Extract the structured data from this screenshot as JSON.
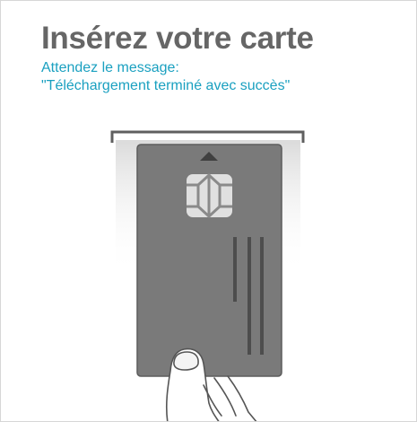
{
  "screen": {
    "title": "Insérez votre carte",
    "instruction_line1": "Attendez le message:",
    "instruction_line2": "\"Téléchargement terminé avec succès\""
  },
  "illustration": {
    "icons": [
      "card-reader-slot-icon",
      "smart-card-icon",
      "chip-icon",
      "insert-arrow-icon",
      "hand-icon"
    ]
  },
  "colors": {
    "title": "#666666",
    "instruction": "#1aa0c0",
    "card": "#7a7a7a",
    "card_border": "#5a5a5a",
    "chip": "#e0e0e0",
    "background": "#ffffff"
  }
}
